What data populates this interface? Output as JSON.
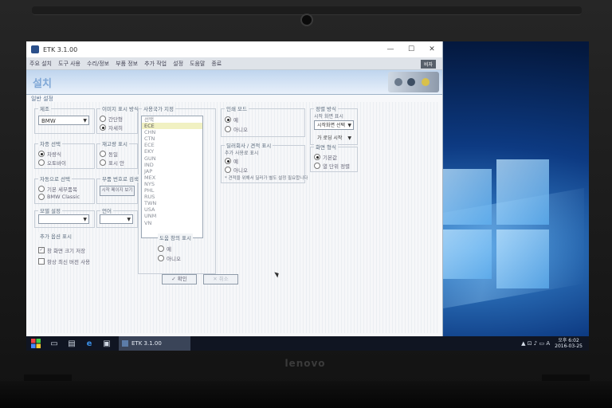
{
  "window": {
    "title": "ETK 3.1.00",
    "controls": {
      "minimize": "—",
      "maximize": "☐",
      "close": "✕"
    }
  },
  "menu": {
    "items": [
      "주요 설치",
      "도구 사용",
      "수리/정보",
      "부품 정보",
      "추가 작업",
      "설정",
      "도움말",
      "종료"
    ],
    "badge": "비자"
  },
  "page": {
    "title": "설치",
    "tab": "일반 설정"
  },
  "groups": {
    "brand": {
      "label": "제조",
      "selected": "BMW"
    },
    "image_view": {
      "label": "이미지 표시 방식",
      "options": [
        "간단형",
        "자세히"
      ]
    },
    "region": {
      "label": "사용국가 지정",
      "items": [
        "선택",
        "ECE",
        "CHN",
        "CTN",
        "ECE",
        "EKY",
        "GUN",
        "IND",
        "JAP",
        "MEX",
        "NYS",
        "PHL",
        "RUS",
        "TWN",
        "USA",
        "UNM",
        "VN"
      ],
      "selected_index": 1
    },
    "print": {
      "label": "인쇄 모드",
      "options": [
        "예",
        "아니오"
      ]
    },
    "vehicle_type": {
      "label": "차종 선택",
      "options": [
        "차량식",
        "오토바이"
      ]
    },
    "status": {
      "label": "재고량 표시",
      "options": [
        "동일",
        "표시 안"
      ]
    },
    "part_group": {
      "label": "자동으로 선택",
      "options": [
        "기본 세부품목",
        "BMW Classic"
      ]
    },
    "search": {
      "label": "부품 번호로 검색",
      "button": "시작 페이지 보기"
    },
    "model_year": {
      "label": "모델 설정",
      "selected": ""
    },
    "lang": {
      "label": "언어",
      "selected": ""
    },
    "dealer": {
      "label": "딜러회사 / 견적 표시",
      "sub": "추가 사용료 표시",
      "options": [
        "예",
        "아니오"
      ],
      "note": "* 견적을 위해서 딜러가 별도 설정 필요합니다"
    },
    "sort": {
      "label": "정렬 방식",
      "sub": "시작 화면 표시",
      "selected": "시작화면 선택",
      "second": "가 로딩 시작"
    },
    "display_mode": {
      "label": "화면 형식",
      "options": [
        "기본값",
        "열 단위 정렬"
      ]
    },
    "options": {
      "label": "추가 옵션 표시",
      "checks": [
        "창 화면 크기 저장",
        "항상 최신 버전 사용"
      ]
    },
    "ok_display": {
      "label": "도움 창의 표시",
      "options": [
        "예",
        "아니오"
      ]
    }
  },
  "buttons": {
    "ok": "확인",
    "cancel": "취소"
  },
  "taskbar": {
    "task_label": "ETK 3.1.00",
    "tray": "▲ ⊡ ♪ ▭ A",
    "time": "오후 6:02",
    "date": "2016-03-25"
  },
  "brand_label": "lenovo"
}
